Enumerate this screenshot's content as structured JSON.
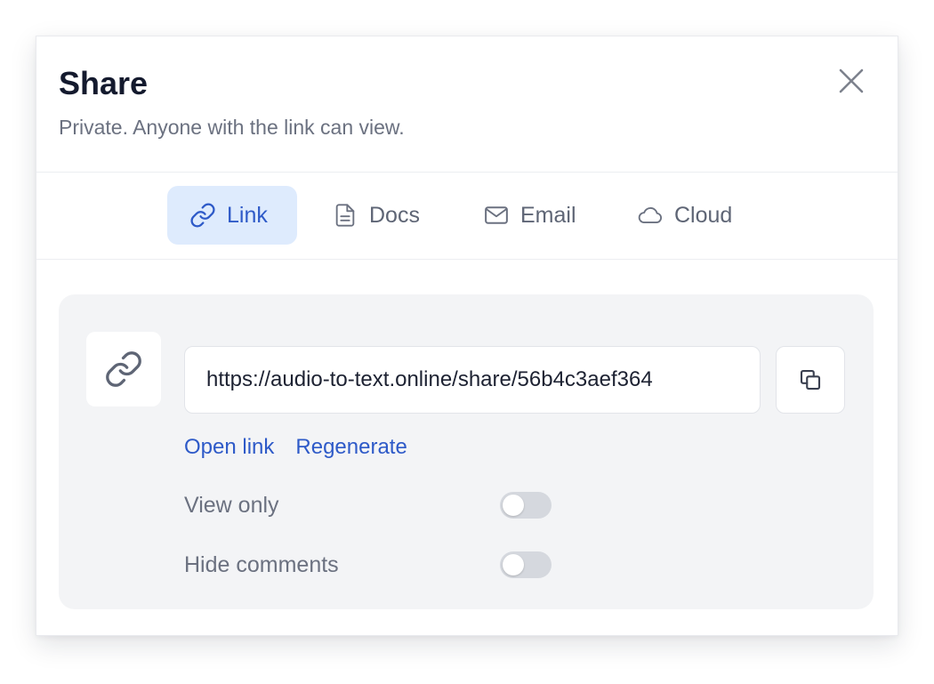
{
  "dialog": {
    "title": "Share",
    "subtitle": "Private. Anyone with the link can view."
  },
  "tabs": [
    {
      "label": "Link",
      "icon": "link-icon",
      "active": true
    },
    {
      "label": "Docs",
      "icon": "document-icon",
      "active": false
    },
    {
      "label": "Email",
      "icon": "envelope-icon",
      "active": false
    },
    {
      "label": "Cloud",
      "icon": "cloud-icon",
      "active": false
    }
  ],
  "link_panel": {
    "url": "https://audio-to-text.online/share/56b4c3aef364",
    "open_link_label": "Open link",
    "regenerate_label": "Regenerate",
    "toggles": [
      {
        "label": "View only",
        "on": false
      },
      {
        "label": "Hide comments",
        "on": false
      }
    ]
  },
  "colors": {
    "accent": "#2e5ac8",
    "active_tab_bg": "#deebfd",
    "panel_bg": "#f3f4f6",
    "toggle_off": "#d5d8de"
  }
}
